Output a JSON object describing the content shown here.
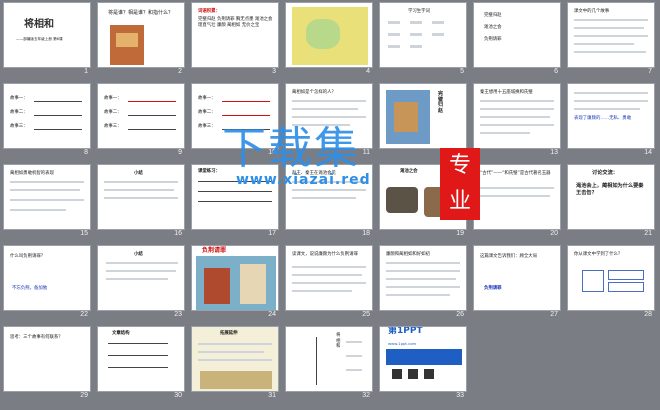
{
  "slides": [
    {
      "n": "1",
      "title": "将相和",
      "sub": "——部编版五年级上册 第6课"
    },
    {
      "n": "2",
      "text": "将是谁？相是谁？和指什么？"
    },
    {
      "n": "3",
      "head": "词语积累：",
      "text": "完璧归赵 负荆请罪 胸无点墨 渑池之会 理直气壮 廉颇 蔺相如 无价之宝"
    },
    {
      "n": "4"
    },
    {
      "n": "5",
      "head": "学习生字词"
    },
    {
      "n": "6",
      "items": [
        "完璧归赵",
        "渑池之会",
        "负荆请罪"
      ]
    },
    {
      "n": "7",
      "text": "课文中的几个故事"
    },
    {
      "n": "8",
      "a": "故事一：",
      "b": "故事二：",
      "c": "故事三："
    },
    {
      "n": "9",
      "a": "故事一：",
      "b": "故事二：",
      "c": "故事三："
    },
    {
      "n": "10",
      "a": "故事一：",
      "b": "故事二：",
      "c": "故事三："
    },
    {
      "n": "11",
      "text": "蔺相如是个怎样的人？"
    },
    {
      "n": "12",
      "label": "完璧归赵"
    },
    {
      "n": "13",
      "text": "秦王想用十五座城换和氏璧"
    },
    {
      "n": "14",
      "text": "表现了廉颇的……无私、勇敢"
    },
    {
      "n": "15",
      "text": "蔺相如勇敢机智的表现"
    },
    {
      "n": "16",
      "head": "小结"
    },
    {
      "n": "17",
      "head": "课堂练习："
    },
    {
      "n": "18",
      "text": "赵王、秦王在渑池会见"
    },
    {
      "n": "19",
      "head": "渑池之会"
    },
    {
      "n": "20",
      "text": "“古代”——“和氏璧”是古代著名玉器"
    },
    {
      "n": "21",
      "head": "讨论交流：",
      "text": "渑池会上，蔺相如为什么要秦王击缶？"
    },
    {
      "n": "22",
      "text": "什么叫负荆请罪？",
      "foot": "不忘负荆，备加勉"
    },
    {
      "n": "23",
      "head": "小结"
    },
    {
      "n": "24",
      "head": "负荆请罪"
    },
    {
      "n": "25",
      "text": "读课文，说说廉颇为什么负荆请罪"
    },
    {
      "n": "26",
      "text": "廉颇和蔺相如和好如初"
    },
    {
      "n": "27",
      "text": "这篇课文告诉我们：顾全大局",
      "foot": "负荆请罪"
    },
    {
      "n": "28",
      "text": "你从课文中学到了什么？"
    },
    {
      "n": "29",
      "text": "思考：三个故事有何联系？"
    },
    {
      "n": "30",
      "head": "文章结构"
    },
    {
      "n": "31",
      "head": "拓展延伸"
    },
    {
      "n": "32",
      "text": "将相和"
    },
    {
      "n": "33",
      "brand": "第1PPT",
      "sub": "www.1ppt.com"
    }
  ],
  "watermark": {
    "main": "下载集",
    "sub": "www.xiazai.red",
    "seal": "专业"
  },
  "colors": {
    "background": "#7a7d83",
    "accent": "#2e8fe8",
    "red": "#e01818"
  }
}
